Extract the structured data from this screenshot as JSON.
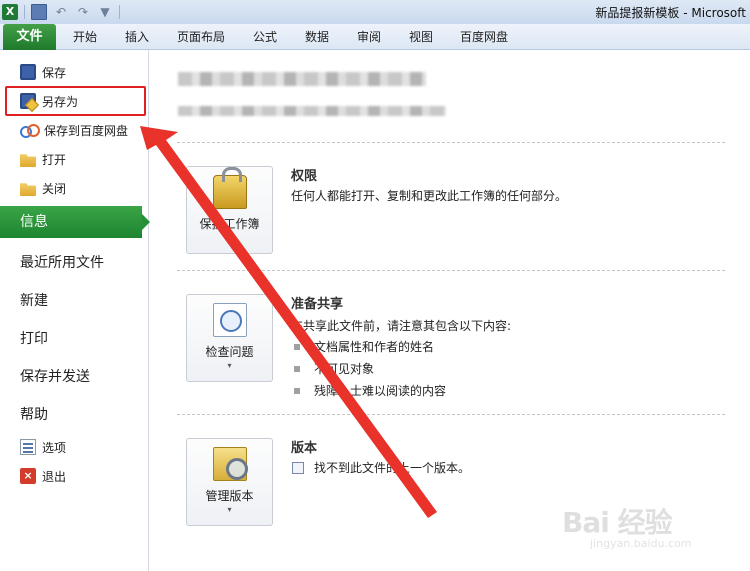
{
  "window": {
    "title": "新品提报新模板 - Microsoft"
  },
  "quick_access": {
    "app_icon": "excel-icon",
    "items": [
      "save-icon",
      "undo-icon",
      "redo-icon",
      "filter-icon"
    ]
  },
  "ribbon": {
    "file_tab": "文件",
    "tabs": [
      "开始",
      "插入",
      "页面布局",
      "公式",
      "数据",
      "审阅",
      "视图",
      "百度网盘"
    ]
  },
  "nav": {
    "save": "保存",
    "save_as": "另存为",
    "save_to_baidu": "保存到百度网盘",
    "open": "打开",
    "close": "关闭",
    "info": "信息",
    "recent": "最近所用文件",
    "new": "新建",
    "print": "打印",
    "save_send": "保存并发送",
    "help": "帮助",
    "options": "选项",
    "exit": "退出"
  },
  "sections": {
    "permissions": {
      "button": "保护工作簿",
      "title": "权限",
      "text": "任何人都能打开、复制和更改此工作簿的任何部分。"
    },
    "prepare": {
      "button": "检查问题",
      "title": "准备共享",
      "text": "在共享此文件前，请注意其包含以下内容:",
      "items": [
        "文档属性和作者的姓名",
        "不可见对象",
        "残障人士难以阅读的内容"
      ]
    },
    "versions": {
      "button": "管理版本",
      "title": "版本",
      "text": "找不到此文件的上一个版本。"
    }
  },
  "watermark": {
    "text": "Bai 经验",
    "sub": "jingyan.baidu.com"
  },
  "colors": {
    "file_tab": "#2a8c3a",
    "info_selected": "#259038",
    "highlight": "#e02020",
    "arrow": "#e8322a"
  }
}
